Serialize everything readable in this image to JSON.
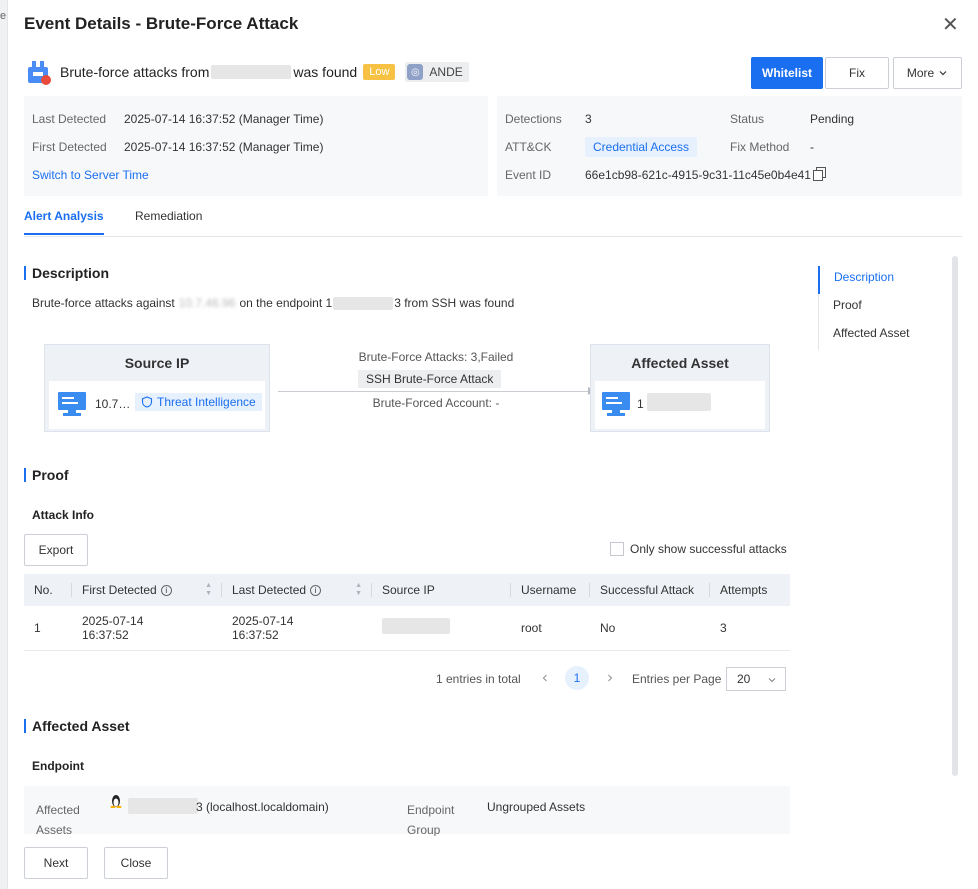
{
  "sidebar_char": "e",
  "dialog": {
    "title": "Event Details - Brute-Force Attack",
    "close_glyph": "✕"
  },
  "event": {
    "text_prefix": "Brute-force attacks from",
    "text_suffix": "was found",
    "severity": "Low",
    "source_badge": "ANDE"
  },
  "actions": {
    "whitelist": "Whitelist",
    "fix": "Fix",
    "more": "More"
  },
  "summary_left": {
    "last_detected_label": "Last Detected",
    "last_detected_value": "2025-07-14 16:37:52 (Manager Time)",
    "first_detected_label": "First Detected",
    "first_detected_value": "2025-07-14 16:37:52 (Manager Time)",
    "switch_link": "Switch to Server Time"
  },
  "summary_right": {
    "detections_label": "Detections",
    "detections_value": "3",
    "attck_label": "ATT&CK",
    "attck_value": "Credential Access",
    "event_id_label": "Event ID",
    "event_id_value": "66e1cb98-621c-4915-9c31-11c45e0b4e41",
    "status_label": "Status",
    "status_value": "Pending",
    "fix_method_label": "Fix Method",
    "fix_method_value": "-"
  },
  "tabs": [
    "Alert Analysis",
    "Remediation"
  ],
  "description": {
    "heading": "Description",
    "text_1": "Brute-force attacks against",
    "text_masked_1": "10.7.46.96",
    "text_2": "on the endpoint 1",
    "text_3": "3 from SSH was found"
  },
  "graph": {
    "source_title": "Source IP",
    "source_ip": "10.7…",
    "threat_intel": "Threat Intelligence",
    "edge_line1": "Brute-Force Attacks: 3,Failed",
    "edge_tag": "SSH Brute-Force Attack",
    "edge_line3": "Brute-Forced Account: -",
    "asset_title": "Affected Asset",
    "asset_ip": "1"
  },
  "side_nav": [
    "Description",
    "Proof",
    "Affected Asset"
  ],
  "proof": {
    "heading": "Proof",
    "subheading": "Attack Info",
    "export": "Export",
    "only_success": "Only show successful attacks",
    "columns": [
      "No.",
      "First Detected",
      "Last Detected",
      "Source IP",
      "Username",
      "Successful Attack",
      "Attempts"
    ],
    "rows": [
      {
        "no": "1",
        "first_date": "2025-07-14",
        "first_time": "16:37:52",
        "last_date": "2025-07-14",
        "last_time": "16:37:52",
        "username": "root",
        "success": "No",
        "attempts": "3"
      }
    ],
    "total": "1 entries in total",
    "page": "1",
    "per_page_label": "Entries per Page",
    "per_page_value": "20"
  },
  "affected_asset": {
    "heading": "Affected Asset",
    "subheading": "Endpoint",
    "affected_label_1": "Affected",
    "affected_label_2": "Assets",
    "host_suffix": "3 (localhost.localdomain)",
    "group_label_1": "Endpoint",
    "group_label_2": "Group",
    "group_value": "Ungrouped Assets"
  },
  "footer": {
    "next": "Next",
    "close": "Close"
  },
  "colors": {
    "primary": "#1a6ff0",
    "low": "#f7c244"
  }
}
